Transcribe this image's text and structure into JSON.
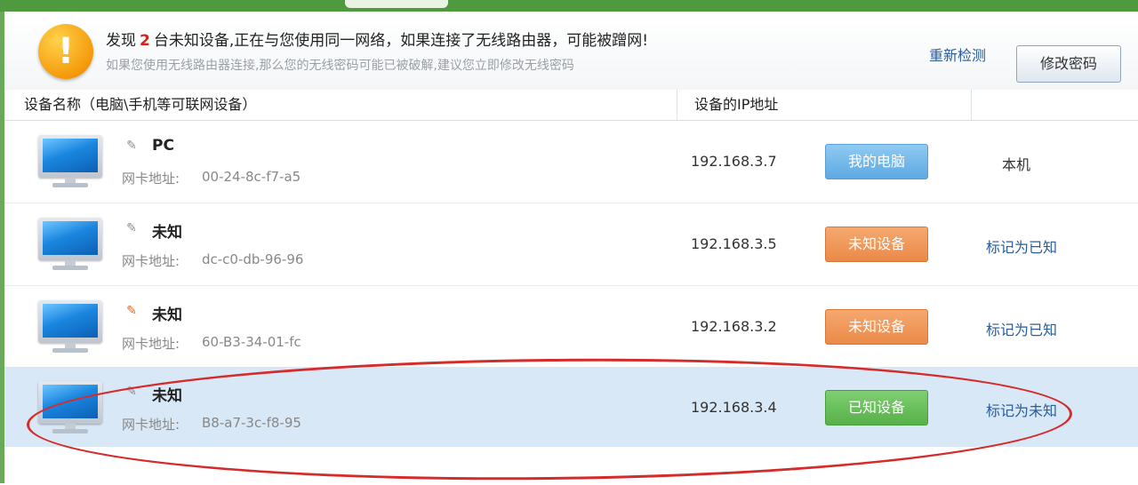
{
  "alert": {
    "title_prefix": "发现",
    "title_count": "2",
    "title_suffix": "台未知设备,正在与您使用同一网络，如果连接了无线路由器，可能被蹭网!",
    "subtitle": "如果您使用无线路由器连接,那么您的无线密码可能已被破解,建议您立即修改无线密码",
    "redetect_label": "重新检测",
    "change_password_label": "修改密码",
    "icon": "warning-icon"
  },
  "table": {
    "headers": {
      "device_name": "设备名称（电脑\\手机等可联网设备）",
      "ip": "设备的IP地址"
    },
    "mac_label": "网卡地址:",
    "rows": [
      {
        "name": "PC",
        "mac": "00-24-8c-f7-a5",
        "ip": "192.168.3.7",
        "tag": "我的电脑",
        "tag_color": "#5ea9e2",
        "action": "本机",
        "action_is_link": false
      },
      {
        "name": "未知",
        "mac": "dc-c0-db-96-96",
        "ip": "192.168.3.5",
        "tag": "未知设备",
        "tag_color": "#ea8a48",
        "action": "标记为已知",
        "action_is_link": true
      },
      {
        "name": "未知",
        "mac": "60-B3-34-01-fc",
        "ip": "192.168.3.2",
        "tag": "未知设备",
        "tag_color": "#ea8a48",
        "action": "标记为已知",
        "action_is_link": true
      },
      {
        "name": "未知",
        "mac": "B8-a7-3c-f8-95",
        "ip": "192.168.3.4",
        "tag": "已知设备",
        "tag_color": "#57b149",
        "action": "标记为未知",
        "action_is_link": true
      }
    ]
  },
  "colors": {
    "accent_green": "#4f9a3e",
    "count_red": "#d3241a",
    "link_blue": "#2a5d9a",
    "highlight_red": "#d62b2b"
  }
}
